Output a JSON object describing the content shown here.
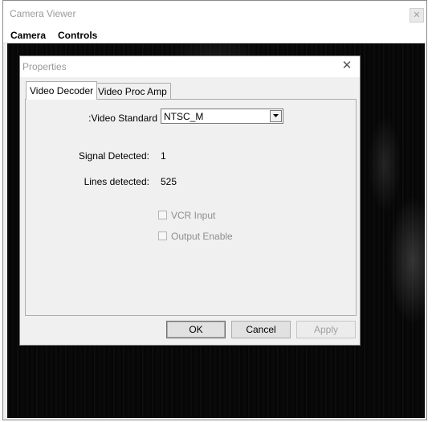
{
  "window": {
    "title": "Camera Viewer",
    "close_glyph": "✕",
    "menu": [
      "Camera",
      "Controls"
    ]
  },
  "dialog": {
    "title": "Properties",
    "close_glyph": "✕",
    "tabs": [
      {
        "label": "Video Decoder",
        "active": true
      },
      {
        "label": "Video Proc Amp",
        "active": false
      }
    ],
    "video_standard": {
      "label": ":Video Standard",
      "value": "NTSC_M"
    },
    "signal_detected": {
      "label": "Signal Detected:",
      "value": "1"
    },
    "lines_detected": {
      "label": "Lines detected:",
      "value": "525"
    },
    "checkboxes": [
      {
        "label": "VCR Input",
        "checked": false,
        "enabled": false
      },
      {
        "label": "Output Enable",
        "checked": false,
        "enabled": false
      }
    ],
    "buttons": {
      "ok": "OK",
      "cancel": "Cancel",
      "apply": "Apply"
    }
  }
}
